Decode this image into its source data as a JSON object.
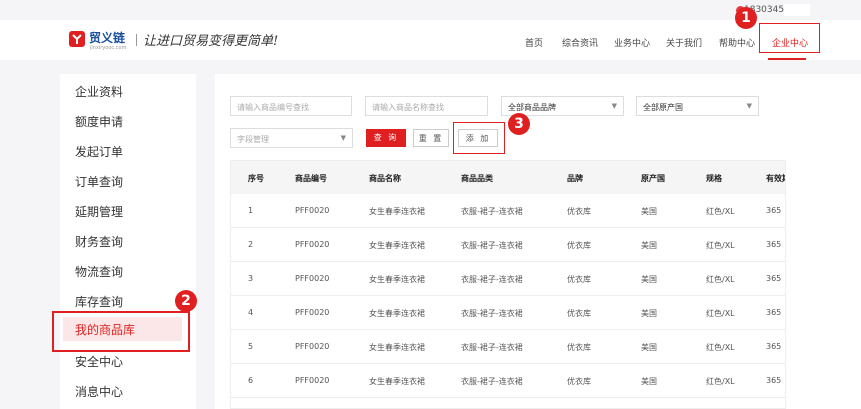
{
  "top_bar": {
    "phone": "1830345"
  },
  "header": {
    "logo_name": "贸义链",
    "logo_domain": "jinxiryooc.com",
    "slogan": "让进口贸易变得更简单!"
  },
  "nav": {
    "items": [
      {
        "label": "首页"
      },
      {
        "label": "综合资讯"
      },
      {
        "label": "业务中心"
      },
      {
        "label": "关于我们"
      },
      {
        "label": "帮助中心"
      },
      {
        "label": "企业中心",
        "active": true
      }
    ]
  },
  "sidebar": {
    "items": [
      {
        "label": "企业资料"
      },
      {
        "label": "额度申请"
      },
      {
        "label": "发起订单"
      },
      {
        "label": "订单查询"
      },
      {
        "label": "延期管理"
      },
      {
        "label": "财务查询"
      },
      {
        "label": "物流查询"
      },
      {
        "label": "库存查询"
      },
      {
        "label": "我的商品库",
        "active": true
      },
      {
        "label": "安全中心"
      },
      {
        "label": "消息中心"
      }
    ]
  },
  "filters": {
    "code_placeholder": "请输入商品编号查找",
    "name_placeholder": "请输入商品名称查找",
    "brand_select": "全部商品品牌",
    "origin_select": "全部原产国",
    "field_select": "字段管理",
    "query_label": "查 询",
    "reset_label": "重 置",
    "add_label": "添 加"
  },
  "table": {
    "columns": [
      "序号",
      "商品编号",
      "商品名称",
      "商品品类",
      "品牌",
      "原产国",
      "规格",
      "有效期"
    ],
    "rows": [
      [
        "1",
        "PFF0020",
        "女生春季连衣裙",
        "衣服-裙子-连衣裙",
        "优衣库",
        "美国",
        "红色/XL",
        "365"
      ],
      [
        "2",
        "PFF0020",
        "女生春季连衣裙",
        "衣服-裙子-连衣裙",
        "优衣库",
        "美国",
        "红色/XL",
        "365"
      ],
      [
        "3",
        "PFF0020",
        "女生春季连衣裙",
        "衣服-裙子-连衣裙",
        "优衣库",
        "美国",
        "红色/XL",
        "365"
      ],
      [
        "4",
        "PFF0020",
        "女生春季连衣裙",
        "衣服-裙子-连衣裙",
        "优衣库",
        "美国",
        "红色/XL",
        "365"
      ],
      [
        "5",
        "PFF0020",
        "女生春季连衣裙",
        "衣服-裙子-连衣裙",
        "优衣库",
        "美国",
        "红色/XL",
        "365"
      ],
      [
        "6",
        "PFF0020",
        "女生春季连衣裙",
        "衣服-裙子-连衣裙",
        "优衣库",
        "美国",
        "红色/XL",
        "365"
      ]
    ]
  },
  "annotations": {
    "badge_1": "1",
    "badge_2": "2",
    "badge_3": "3"
  },
  "colors": {
    "accent": "#e02020",
    "logo_blue": "#1a4f9c",
    "page_bg": "#f5f5f7"
  }
}
